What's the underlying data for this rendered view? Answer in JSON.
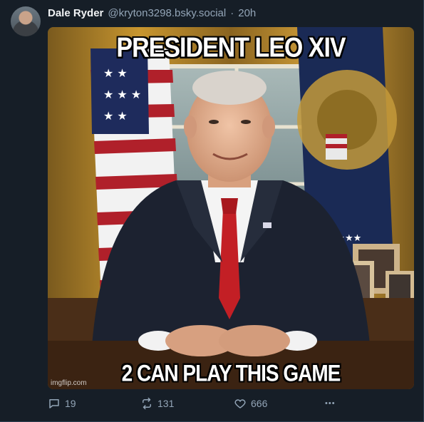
{
  "post": {
    "author_name": "Dale Ryder",
    "author_handle": "@kryton3298.bsky.social",
    "separator": "·",
    "timestamp": "20h",
    "media": {
      "top_text": "PRESIDENT LEO XIV",
      "bottom_text": "2 CAN PLAY THIS GAME",
      "watermark": "imgflip.com"
    },
    "stats": {
      "replies": "19",
      "reposts": "131",
      "likes": "666"
    },
    "more_label": "•••"
  },
  "colors": {
    "background": "#161e27",
    "text_primary": "#f1f3f5",
    "text_secondary": "#93a5b7"
  },
  "icons": [
    "reply-icon",
    "repost-icon",
    "heart-icon",
    "more-icon"
  ]
}
